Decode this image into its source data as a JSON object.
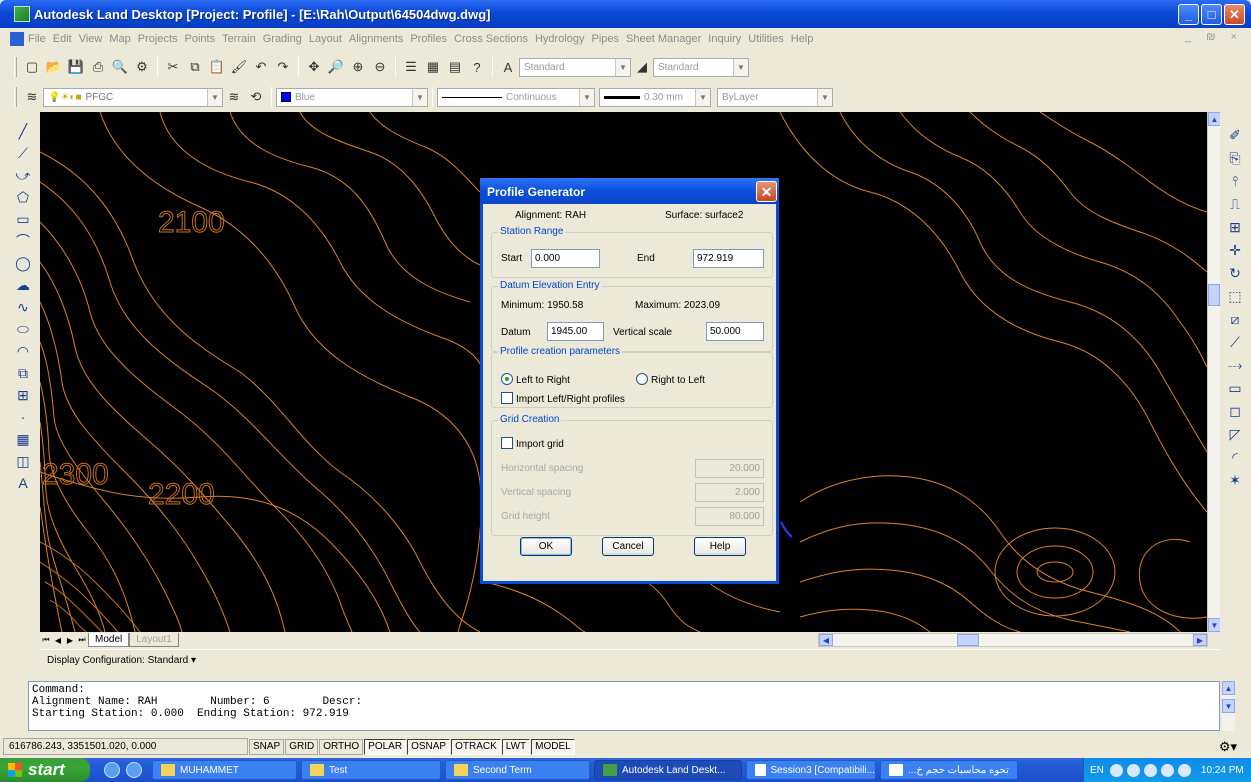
{
  "window": {
    "title": "Autodesk Land Desktop [Project: Profile] - [E:\\Rah\\Output\\64504dwg.dwg]",
    "min": "_",
    "max": "□",
    "close": "✕"
  },
  "menu": [
    "File",
    "Edit",
    "View",
    "Map",
    "Projects",
    "Points",
    "Terrain",
    "Grading",
    "Layout",
    "Alignments",
    "Profiles",
    "Cross Sections",
    "Hydrology",
    "Pipes",
    "Sheet Manager",
    "Inquiry",
    "Utilities",
    "Help"
  ],
  "mdi_controls": "_ ₪ ×",
  "toolbar": {
    "text_style": "Standard",
    "dim_style": "Standard",
    "layer": "PFGC",
    "color": "Blue",
    "linetype": "Continuous",
    "lineweight": "0.30 mm",
    "plotstyle": "ByLayer",
    "colors": {
      "layer_swatch": "#0000ff"
    }
  },
  "drawing": {
    "labels": [
      "2100",
      "2300",
      "2200"
    ],
    "colors": {
      "contour": "#d9822b",
      "contour_major": "#c8701f",
      "polyline": "#2040ff",
      "background": "#000000"
    }
  },
  "layout_tabs": {
    "nav": [
      "⏮",
      "◀",
      "▶",
      "⏭"
    ],
    "model": "Model",
    "layout1": "Layout1"
  },
  "display_config": "Display Configuration:  Standard ▾",
  "command": {
    "lines": [
      "Command:",
      "Alignment Name: RAH        Number: 6        Descr:",
      "Starting Station: 0.000  Ending Station: 972.919"
    ]
  },
  "status": {
    "coords": "616786.243, 3351501.020, 0.000",
    "buttons": [
      {
        "label": "SNAP",
        "on": false
      },
      {
        "label": "GRID",
        "on": false
      },
      {
        "label": "ORTHO",
        "on": false
      },
      {
        "label": "POLAR",
        "on": true
      },
      {
        "label": "OSNAP",
        "on": true
      },
      {
        "label": "OTRACK",
        "on": true
      },
      {
        "label": "LWT",
        "on": true
      },
      {
        "label": "MODEL",
        "on": true
      }
    ]
  },
  "dialog": {
    "title": "Profile Generator",
    "alignment": "Alignment: RAH",
    "surface": "Surface: surface2",
    "station_range": {
      "label": "Station Range",
      "start_label": "Start",
      "start": "0.000",
      "end_label": "End",
      "end": "972.919"
    },
    "datum_entry": {
      "label": "Datum Elevation Entry",
      "minimum": "Minimum: 1950.58",
      "maximum": "Maximum: 2023.09",
      "datum_label": "Datum",
      "datum": "1945.00",
      "vscale_label": "Vertical scale",
      "vscale": "50.000"
    },
    "params": {
      "label": "Profile creation parameters",
      "left_to_right": "Left to Right",
      "right_to_left": "Right to Left",
      "import_lr": "Import Left/Right profiles",
      "direction_selected": "Left to Right"
    },
    "grid": {
      "label": "Grid Creation",
      "import_grid": "Import grid",
      "hspacing_label": "Horizontal spacing",
      "hspacing": "20.000",
      "vspacing_label": "Vertical spacing",
      "vspacing": "2.000",
      "height_label": "Grid height",
      "height": "80.000"
    },
    "buttons": {
      "ok": "OK",
      "cancel": "Cancel",
      "help": "Help"
    }
  },
  "taskbar": {
    "start": "start",
    "tasks": [
      "MUHAMMET",
      "Test",
      "Second Term",
      "Autodesk Land Deskt...",
      "Session3 [Compatibili...",
      "...تحوه محاسبات حجم خ"
    ],
    "tray": {
      "lang": "EN",
      "time": "10:24 PM"
    }
  }
}
